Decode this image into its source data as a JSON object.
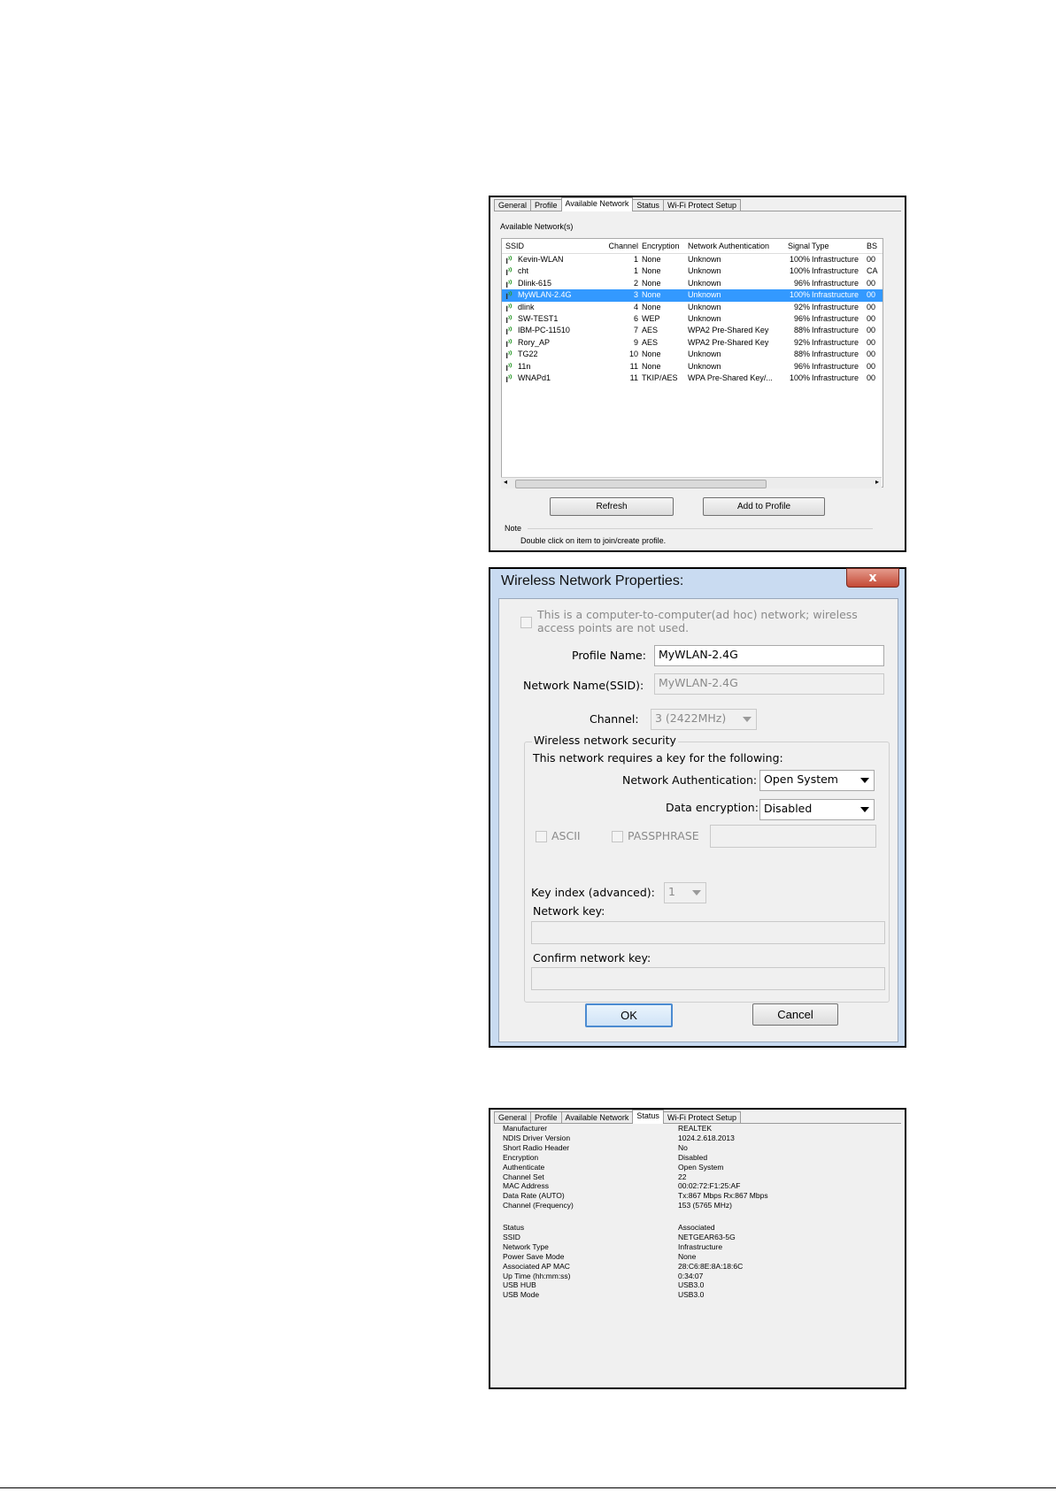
{
  "tabs": [
    "General",
    "Profile",
    "Available Network",
    "Status",
    "Wi-Fi Protect Setup"
  ],
  "available": {
    "section_label": "Available Network(s)",
    "columns": {
      "ssid": "SSID",
      "channel": "Channel",
      "encryption": "Encryption",
      "auth": "Network Authentication",
      "signal": "Signal",
      "type": "Type",
      "bssid": "BS"
    },
    "rows": [
      {
        "ssid": "Kevin-WLAN",
        "channel": "1",
        "encryption": "None",
        "auth": "Unknown",
        "signal": "100%",
        "type": "Infrastructure",
        "bssid": "00"
      },
      {
        "ssid": "cht",
        "channel": "1",
        "encryption": "None",
        "auth": "Unknown",
        "signal": "100%",
        "type": "Infrastructure",
        "bssid": "CA"
      },
      {
        "ssid": "Dlink-615",
        "channel": "2",
        "encryption": "None",
        "auth": "Unknown",
        "signal": "96%",
        "type": "Infrastructure",
        "bssid": "00"
      },
      {
        "ssid": "MyWLAN-2.4G",
        "channel": "3",
        "encryption": "None",
        "auth": "Unknown",
        "signal": "100%",
        "type": "Infrastructure",
        "bssid": "00"
      },
      {
        "ssid": "dlink",
        "channel": "4",
        "encryption": "None",
        "auth": "Unknown",
        "signal": "92%",
        "type": "Infrastructure",
        "bssid": "00"
      },
      {
        "ssid": "SW-TEST1",
        "channel": "6",
        "encryption": "WEP",
        "auth": "Unknown",
        "signal": "96%",
        "type": "Infrastructure",
        "bssid": "00"
      },
      {
        "ssid": "IBM-PC-11510",
        "channel": "7",
        "encryption": "AES",
        "auth": "WPA2 Pre-Shared Key",
        "signal": "88%",
        "type": "Infrastructure",
        "bssid": "00"
      },
      {
        "ssid": "Rory_AP",
        "channel": "9",
        "encryption": "AES",
        "auth": "WPA2 Pre-Shared Key",
        "signal": "92%",
        "type": "Infrastructure",
        "bssid": "00"
      },
      {
        "ssid": "TG22",
        "channel": "10",
        "encryption": "None",
        "auth": "Unknown",
        "signal": "88%",
        "type": "Infrastructure",
        "bssid": "00"
      },
      {
        "ssid": "11n",
        "channel": "11",
        "encryption": "None",
        "auth": "Unknown",
        "signal": "96%",
        "type": "Infrastructure",
        "bssid": "00"
      },
      {
        "ssid": "WNAPd1",
        "channel": "11",
        "encryption": "TKIP/AES",
        "auth": "WPA Pre-Shared Key/...",
        "signal": "100%",
        "type": "Infrastructure",
        "bssid": "00"
      }
    ],
    "selected_index": 3,
    "refresh_label": "Refresh",
    "add_profile_label": "Add to Profile",
    "note_title": "Note",
    "note_text": "Double click on item to join/create profile."
  },
  "dialog": {
    "title": "Wireless Network Properties:",
    "close_glyph": "x",
    "adhoc_text_1": "This is a computer-to-computer(ad hoc) network; wireless",
    "adhoc_text_2": "access points are not used.",
    "profile_name_label": "Profile Name:",
    "profile_name_value": "MyWLAN-2.4G",
    "ssid_label": "Network Name(SSID):",
    "ssid_value": "MyWLAN-2.4G",
    "channel_label": "Channel:",
    "channel_value": "3  (2422MHz)",
    "security_legend": "Wireless network security",
    "key_required_text": "This network requires a key for the following:",
    "auth_label": "Network Authentication:",
    "auth_value": "Open System",
    "encryption_label": "Data encryption:",
    "encryption_value": "Disabled",
    "ascii_label": "ASCII",
    "passphrase_label": "PASSPHRASE",
    "key_index_label": "Key index (advanced):",
    "key_index_value": "1",
    "network_key_label": "Network key:",
    "confirm_key_label": "Confirm network key:",
    "ok_label": "OK",
    "cancel_label": "Cancel"
  },
  "status": {
    "group1": [
      {
        "label": "Manufacturer",
        "value": "REALTEK"
      },
      {
        "label": "NDIS Driver Version",
        "value": "1024.2.618.2013"
      },
      {
        "label": "Short Radio Header",
        "value": "No"
      },
      {
        "label": "Encryption",
        "value": "Disabled"
      },
      {
        "label": "Authenticate",
        "value": "Open System"
      },
      {
        "label": "Channel Set",
        "value": "22"
      },
      {
        "label": "MAC Address",
        "value": "00:02:72:F1:25:AF"
      },
      {
        "label": "Data Rate (AUTO)",
        "value": "Tx:867 Mbps Rx:867 Mbps"
      },
      {
        "label": "Channel (Frequency)",
        "value": "153 (5765 MHz)"
      }
    ],
    "group2": [
      {
        "label": "Status",
        "value": "Associated"
      },
      {
        "label": "SSID",
        "value": "NETGEAR63-5G"
      },
      {
        "label": "Network Type",
        "value": "Infrastructure"
      },
      {
        "label": "Power Save Mode",
        "value": "None"
      },
      {
        "label": "Associated AP MAC",
        "value": "28:C6:8E:8A:18:6C"
      },
      {
        "label": "Up Time (hh:mm:ss)",
        "value": "0:34:07"
      },
      {
        "label": "USB HUB",
        "value": "USB3.0"
      },
      {
        "label": "USB Mode",
        "value": "USB3.0"
      }
    ]
  },
  "colors": {
    "selection": "#3399ff",
    "close_button": "#c44a36",
    "signal_icon": "#2e9c2e"
  }
}
